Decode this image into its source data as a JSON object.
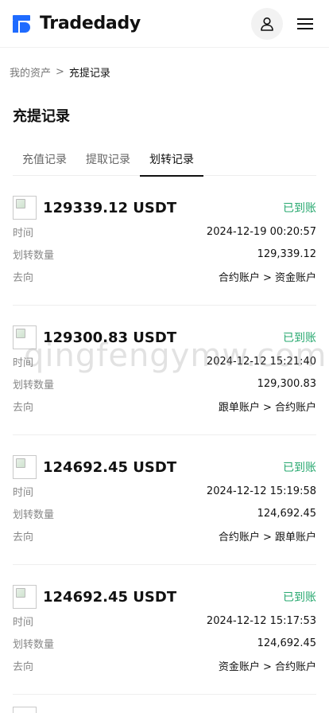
{
  "header": {
    "brand": "Tradedady",
    "icons": {
      "user": "user-icon",
      "menu": "hamburger-menu-icon"
    }
  },
  "breadcrumb": {
    "parent": "我的资产",
    "separator": ">",
    "current": "充提记录"
  },
  "page": {
    "title": "充提记录"
  },
  "tabs": [
    {
      "label": "充值记录",
      "active": false
    },
    {
      "label": "提取记录",
      "active": false
    },
    {
      "label": "划转记录",
      "active": true
    }
  ],
  "records": [
    {
      "amount": "129339.12 USDT",
      "status": "已到账",
      "time_label": "时间",
      "time": "2024-12-19 00:20:57",
      "qty_label": "划转数量",
      "qty": "129,339.12",
      "dir_label": "去向",
      "direction": "合约账户 > 资金账户"
    },
    {
      "amount": "129300.83 USDT",
      "status": "已到账",
      "time_label": "时间",
      "time": "2024-12-12 15:21:40",
      "qty_label": "划转数量",
      "qty": "129,300.83",
      "dir_label": "去向",
      "direction": "跟单账户 > 合约账户"
    },
    {
      "amount": "124692.45 USDT",
      "status": "已到账",
      "time_label": "时间",
      "time": "2024-12-12 15:19:58",
      "qty_label": "划转数量",
      "qty": "124,692.45",
      "dir_label": "去向",
      "direction": "合约账户 > 跟单账户"
    },
    {
      "amount": "124692.45 USDT",
      "status": "已到账",
      "time_label": "时间",
      "time": "2024-12-12 15:17:53",
      "qty_label": "划转数量",
      "qty": "124,692.45",
      "dir_label": "去向",
      "direction": "资金账户 > 合约账户"
    }
  ],
  "watermark": "qingfengymw.com",
  "colors": {
    "brand": "#1f6bff",
    "status": "#27a86f"
  }
}
